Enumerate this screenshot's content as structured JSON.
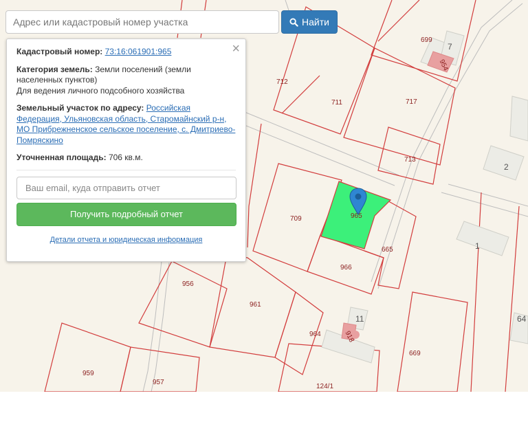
{
  "search": {
    "placeholder": "Адрес или кадастровый номер участка",
    "value": "",
    "button_label": "Найти",
    "button_icon": "search-icon"
  },
  "info_panel": {
    "close_icon": "close-icon",
    "cadastral_label": "Кадастровый номер:",
    "cadastral_number": "73:16:061901:965",
    "category_label": "Категория земель:",
    "category_value": "Земли поселений (земли населенных пунктов)",
    "usage": "Для ведения личного подсобного хозяйства",
    "address_label": "Земельный участок по адресу:",
    "address_value": "Российская Федерация, Ульяновская область, Старомайнский р-н, МО Прибрежненское сельское поселение, с. Дмитриево-Помряскино",
    "area_label": "Уточненная площадь:",
    "area_value": "706 кв.м.",
    "email_placeholder": "Ваш email, куда отправить отчет",
    "report_button": "Получить подробный отчет",
    "details_link": "Детали отчета и юридическая информация"
  },
  "map": {
    "selected_parcel": "965",
    "parcel_labels": [
      "699",
      "712",
      "711",
      "717",
      "713",
      "709",
      "965",
      "665",
      "966",
      "956",
      "961",
      "964",
      "669",
      "959",
      "957",
      "124/1",
      "954",
      "918"
    ],
    "house_numbers": [
      "7",
      "2",
      "1",
      "11",
      "64"
    ],
    "marker_icon": "map-marker-icon",
    "colors": {
      "selected_fill": "#3cf07a",
      "parcel_border": "#d23c3c",
      "building": "#ecece6",
      "building_red": "#e8a0a0",
      "marker": "#2f86d2",
      "background": "#f7f3ea"
    }
  }
}
